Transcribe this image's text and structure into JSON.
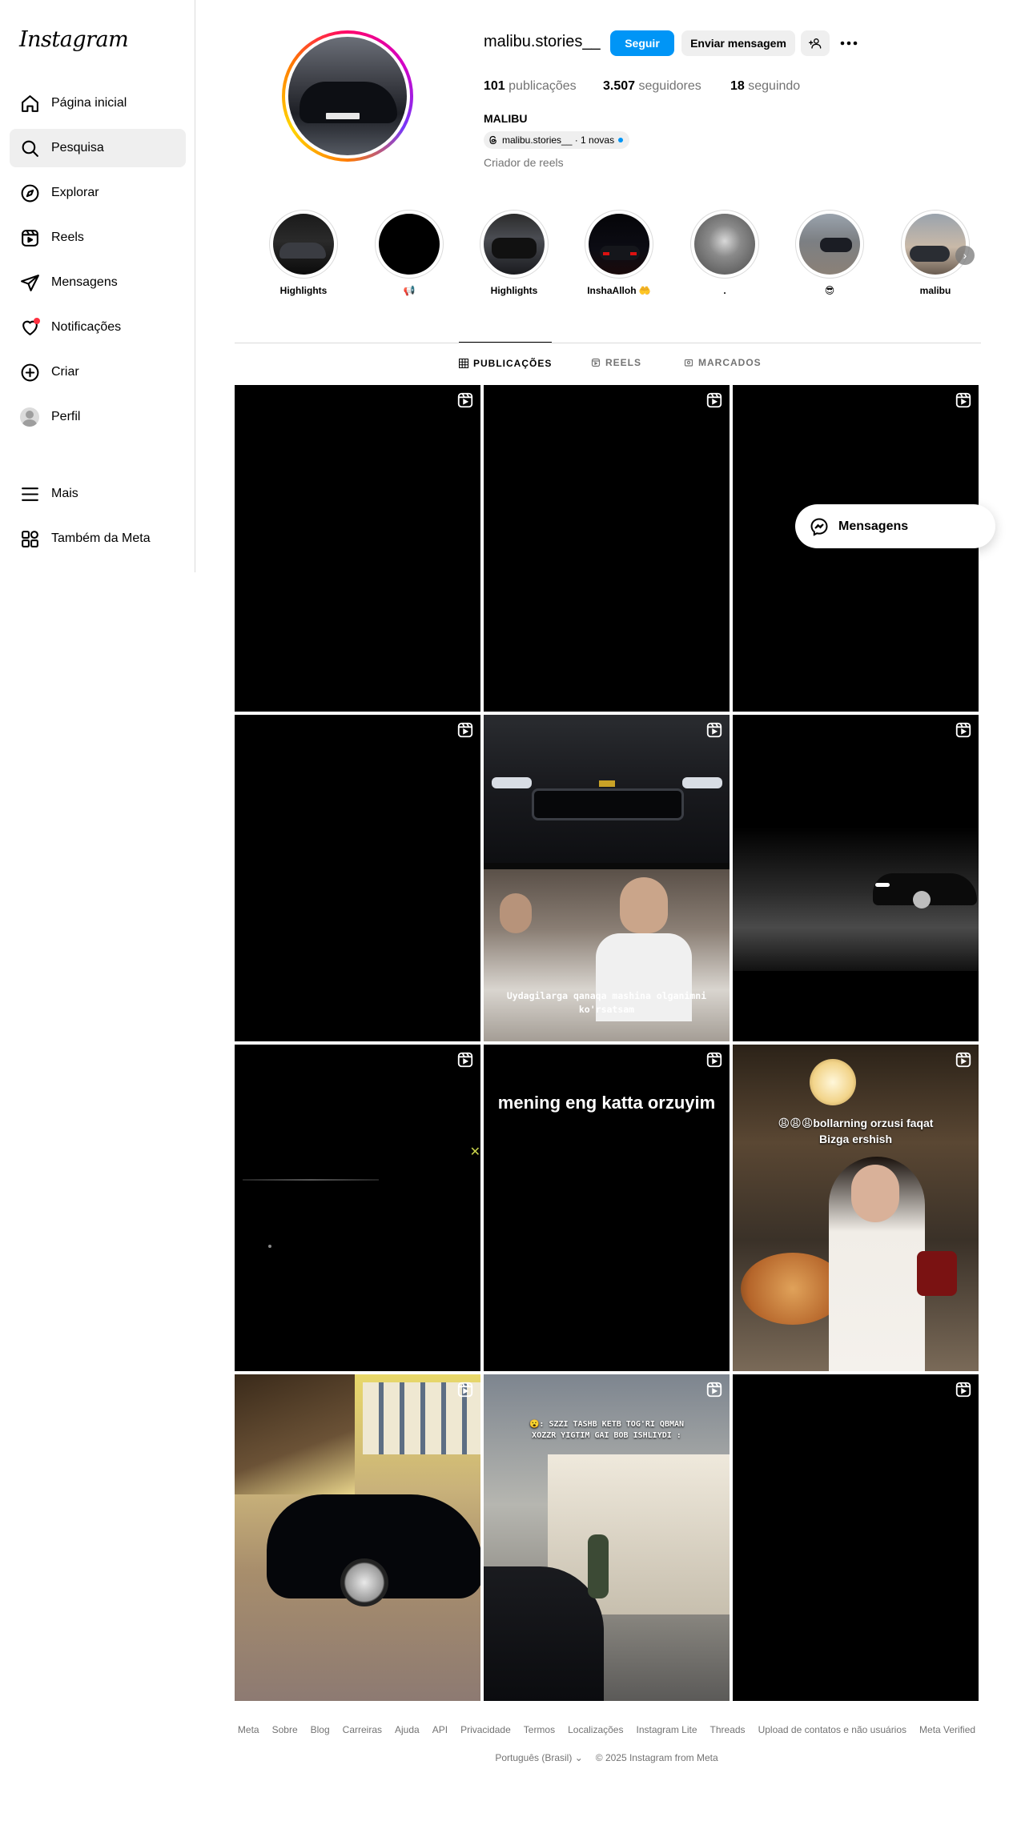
{
  "sidebar": {
    "logo": "Instagram",
    "items": [
      {
        "label": "Página inicial",
        "icon": "home-icon"
      },
      {
        "label": "Pesquisa",
        "icon": "search-icon"
      },
      {
        "label": "Explorar",
        "icon": "compass-icon"
      },
      {
        "label": "Reels",
        "icon": "reels-icon"
      },
      {
        "label": "Mensagens",
        "icon": "send-icon"
      },
      {
        "label": "Notificações",
        "icon": "heart-icon"
      },
      {
        "label": "Criar",
        "icon": "plus-square-icon"
      },
      {
        "label": "Perfil",
        "icon": "avatar"
      },
      {
        "label": "Mais",
        "icon": "menu-icon"
      },
      {
        "label": "Também da Meta",
        "icon": "meta-apps-icon"
      }
    ]
  },
  "profile": {
    "username": "malibu.stories__",
    "follow_label": "Seguir",
    "message_label": "Enviar mensagem",
    "stats": {
      "posts_count": "101",
      "posts_label": "publicações",
      "followers_count": "3.507",
      "followers_label": "seguidores",
      "following_count": "18",
      "following_label": "seguindo"
    },
    "full_name": "MALIBU",
    "threads_chip": "malibu.stories__ · 1 novas",
    "category": "Criador de reels"
  },
  "highlights": [
    {
      "label": "Highlights"
    },
    {
      "label": "📢"
    },
    {
      "label": "Highlights"
    },
    {
      "label": "InshaAlloh 🤲"
    },
    {
      "label": "."
    },
    {
      "label": "😎"
    },
    {
      "label": "malibu"
    }
  ],
  "tabs": [
    {
      "label": "PUBLICAÇÕES",
      "icon": "grid-icon"
    },
    {
      "label": "REELS",
      "icon": "reels-icon"
    },
    {
      "label": "MARCADOS",
      "icon": "tagged-icon"
    }
  ],
  "posts": {
    "p5_caption": "Uydagilarga qanaqa mashina olganimni ko'rsatsam",
    "p8_caption": "mening eng katta orzuyim",
    "p9_caption_1": "😩😩😩bollarning orzusi faqat",
    "p9_caption_2": "Bizga ershish",
    "p11_caption_1": "😮: SZZI TASHB KETB TOG'RI QBMAN",
    "p11_caption_2": "XOZZR YIGTIM GAI BOB ISHLIYDI :"
  },
  "messages_float": {
    "label": "Mensagens"
  },
  "footer": {
    "links": [
      "Meta",
      "Sobre",
      "Blog",
      "Carreiras",
      "Ajuda",
      "API",
      "Privacidade",
      "Termos",
      "Localizações",
      "Instagram Lite",
      "Threads",
      "Upload de contatos e não usuários",
      "Meta Verified"
    ],
    "language": "Português (Brasil)",
    "copyright": "© 2025 Instagram from Meta"
  },
  "colors": {
    "primary_button": "#0095f6",
    "secondary_button": "#efefef",
    "notification_dot": "#ff3040"
  }
}
